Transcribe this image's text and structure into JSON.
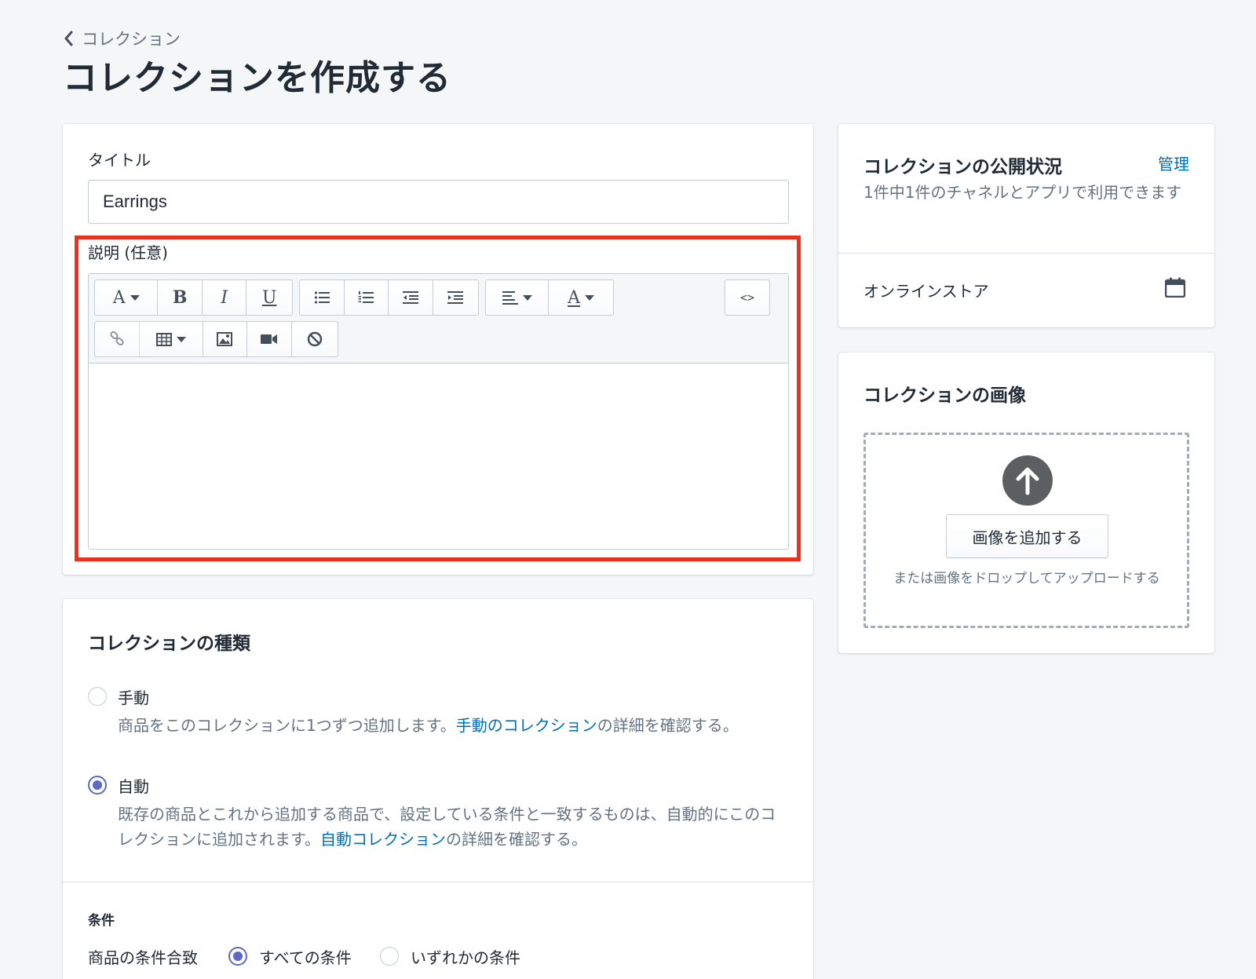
{
  "breadcrumb": {
    "label": "コレクション"
  },
  "page_title": "コレクションを作成する",
  "title_field": {
    "label": "タイトル",
    "value": "Earrings"
  },
  "description_field": {
    "label": "説明 (任意)",
    "toolbar": {
      "row1": [
        "font-icon",
        "bold-icon",
        "italic-icon",
        "underline-icon",
        "bullet-list-icon",
        "numbered-list-icon",
        "outdent-icon",
        "indent-icon",
        "align-left-icon",
        "text-color-icon",
        "html-code-icon"
      ],
      "row2": [
        "link-icon",
        "table-icon",
        "image-icon",
        "video-icon",
        "clear-format-icon"
      ],
      "font_glyph": "A",
      "bold_glyph": "B",
      "italic_glyph": "I",
      "underline_glyph": "U",
      "color_glyph": "A",
      "html_glyph": "<>"
    }
  },
  "collection_type": {
    "title": "コレクションの種類",
    "manual": {
      "label": "手動",
      "help_before": "商品をこのコレクションに1つずつ追加します。",
      "help_link": "手動のコレクション",
      "help_after": "の詳細を確認する。"
    },
    "automatic": {
      "label": "自動",
      "help_before": "既存の商品とこれから追加する商品で、設定している条件と一致するものは、自動的にこのコレクションに追加されます。",
      "help_link": "自動コレクション",
      "help_after": "の詳細を確認する。"
    },
    "selected": "automatic"
  },
  "conditions": {
    "heading": "条件",
    "match_label": "商品の条件合致",
    "options": [
      "すべての条件",
      "いずれかの条件"
    ],
    "selected": "すべての条件"
  },
  "publication": {
    "title": "コレクションの公開状況",
    "manage_link": "管理",
    "subtitle": "1件中1件のチャネルとアプリで利用できます",
    "channel": "オンラインストア"
  },
  "collection_image": {
    "title": "コレクションの画像",
    "add_button": "画像を追加する",
    "hint": "または画像をドロップしてアップロードする"
  },
  "colors": {
    "background": "#f4f6f8",
    "link": "#006fbb",
    "radio_selected": "#5c6ac4",
    "highlight_border": "#e8321f",
    "upload_icon": "#5c5f62"
  }
}
